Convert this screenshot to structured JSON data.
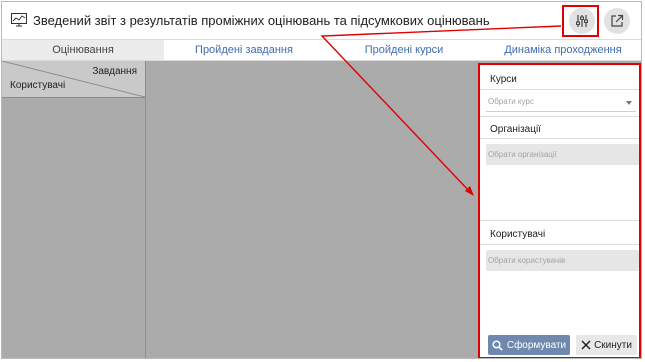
{
  "header": {
    "title": "Зведений звіт з результатів проміжних оцінювань та підсумкових оцінювань",
    "settings_icon": "sliders-icon",
    "external_icon": "external-link-icon"
  },
  "tabs": [
    {
      "label": "Оцінювання",
      "active": true
    },
    {
      "label": "Пройдені завдання",
      "active": false
    },
    {
      "label": "Пройдені курси",
      "active": false
    },
    {
      "label": "Динаміка проходження завдань",
      "active": false
    }
  ],
  "grid": {
    "corner_top": "Завдання",
    "corner_bottom": "Користувачі"
  },
  "filter_panel": {
    "courses": {
      "title": "Курси",
      "placeholder": "Обрати курс"
    },
    "organizations": {
      "title": "Організації",
      "placeholder": "Обрати організації"
    },
    "users": {
      "title": "Користувачі",
      "placeholder": "Обрати користувачів"
    },
    "submit_label": "Сформувати",
    "reset_label": "Скинути"
  },
  "colors": {
    "annotation": "#e00000",
    "accent": "#6f88ae",
    "link": "#3f6bb0"
  }
}
